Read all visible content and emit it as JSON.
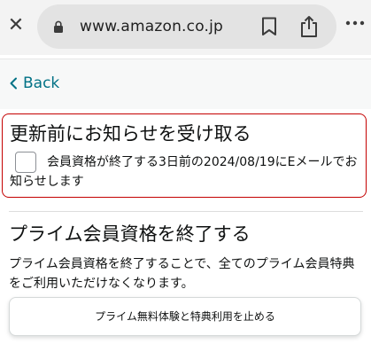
{
  "browser": {
    "url": "www.amazon.co.jp",
    "close_icon": "close-icon",
    "lock_icon": "lock-icon",
    "bookmark_icon": "bookmark-icon",
    "share_icon": "share-icon",
    "more_icon": "more-icon"
  },
  "nav": {
    "back_label": "Back"
  },
  "notify": {
    "title": "更新前にお知らせを受け取る",
    "checkbox_checked": false,
    "text": "会員資格が終了する3日前の2024/08/19にEメールでお知らせします"
  },
  "end_membership": {
    "title": "プライム会員資格を終了する",
    "description": "プライム会員資格を終了することで、全てのプライム会員特典をご利用いただけなくなります。",
    "button_label": "プライム無料体験と特典利用を止める"
  },
  "colors": {
    "link": "#007185",
    "error_border": "#c40000"
  }
}
